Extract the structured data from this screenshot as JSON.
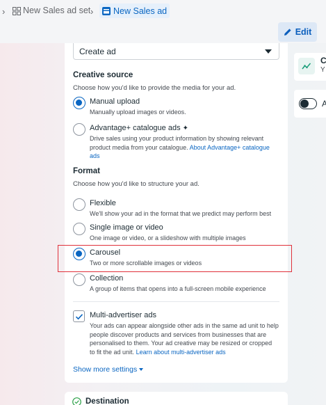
{
  "breadcrumb": {
    "ad_set_label": "New Sales ad set",
    "ad_label": "New Sales ad"
  },
  "header": {
    "edit_label": "Edit"
  },
  "ad_setup": {
    "selected_value": "Create ad"
  },
  "creative_source": {
    "title": "Creative source",
    "description": "Choose how you'd like to provide the media for your ad.",
    "options": [
      {
        "label": "Manual upload",
        "description": "Manually upload images or videos.",
        "selected": true
      },
      {
        "label": "Advantage+ catalogue ads",
        "description": "Drive sales using your product information by showing relevant product media from your catalogue.",
        "link": "About Advantage+ catalogue ads",
        "selected": false
      }
    ]
  },
  "format": {
    "title": "Format",
    "description": "Choose how you'd like to structure your ad.",
    "options": [
      {
        "label": "Flexible",
        "description": "We'll show your ad in the format that we predict may perform best",
        "selected": false
      },
      {
        "label": "Single image or video",
        "description": "One image or video, or a slideshow with multiple images",
        "selected": false
      },
      {
        "label": "Carousel",
        "description": "Two or more scrollable images or videos",
        "selected": true
      },
      {
        "label": "Collection",
        "description": "A group of items that opens into a full-screen mobile experience",
        "selected": false
      }
    ]
  },
  "multi_advertiser": {
    "label": "Multi-advertiser ads",
    "checked": true,
    "description": "Your ads can appear alongside other ads in the same ad unit to help people discover products and services from businesses that are personalised to them. Your ad creative may be resized or cropped to fit the ad unit.",
    "link": "Learn about multi-advertiser ads"
  },
  "show_more_label": "Show more settings",
  "destination": {
    "label": "Destination"
  },
  "side_panel": {
    "card_title": "C",
    "card_subtitle": "Y",
    "toggle_label": "A"
  },
  "colors": {
    "accent": "#0a66c2",
    "highlight": "#e0303a"
  }
}
